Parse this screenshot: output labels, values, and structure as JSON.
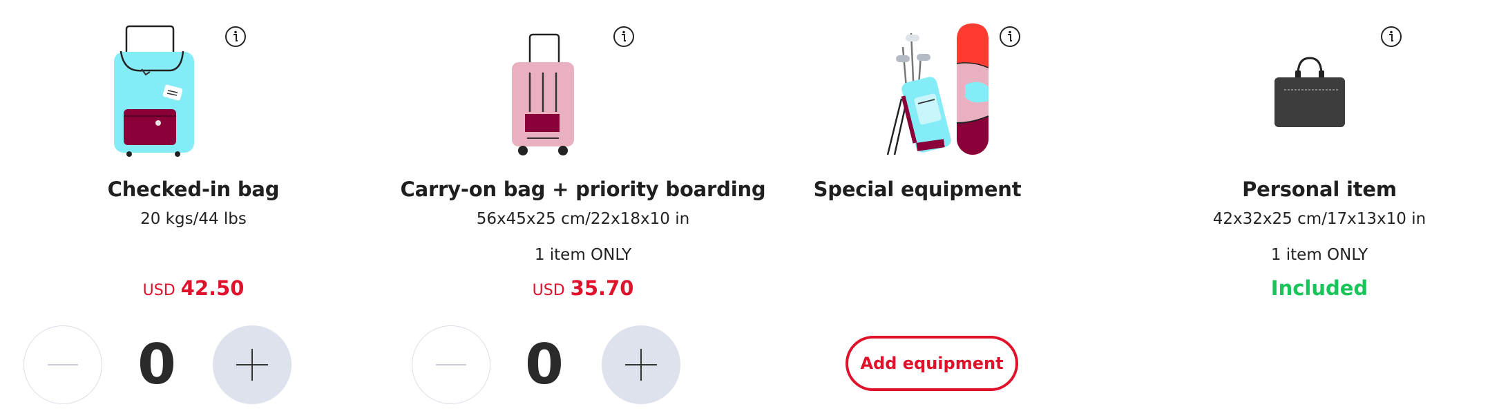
{
  "colors": {
    "price": "#e0112b",
    "included": "#19c55a",
    "button_border": "#e0112b",
    "plus_bg": "#dde2ec"
  },
  "cards": [
    {
      "title": "Checked-in bag",
      "dims": "20 kgs/44 lbs",
      "price_currency": "USD",
      "price_value": "42.50",
      "quantity": "0",
      "icon": "checked-bag-icon"
    },
    {
      "title": "Carry-on bag + priority boarding",
      "dims": "56x45x25 cm/22x18x10 in",
      "limit": "1 item ONLY",
      "price_currency": "USD",
      "price_value": "35.70",
      "quantity": "0",
      "icon": "carry-on-bag-icon"
    },
    {
      "title": "Special equipment",
      "button_label": "Add equipment",
      "icon": "special-equipment-icon"
    },
    {
      "title": "Personal item",
      "dims": "42x32x25 cm/17x13x10 in",
      "limit": "1 item ONLY",
      "status": "Included",
      "icon": "personal-item-icon"
    }
  ]
}
